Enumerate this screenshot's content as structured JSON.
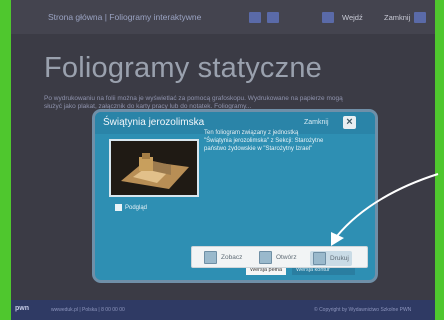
{
  "topbar": {
    "breadcrumb": "Strona główna | Foliogramy interaktywne",
    "icon1": "grid-icon",
    "icon2": "pencil-icon",
    "exit_label": "Wejdź",
    "close_label": "Zamknij"
  },
  "page": {
    "title": "Foliogramy statyczne",
    "intro": "Po wydrukowaniu na folii można je wyświetlać za pomocą grafoskopu. Wydrukowane na papierze mogą służyć jako plakat, załącznik do karty pracy lub do notatek. Foliogramy..."
  },
  "dialog": {
    "title": "Świątynia jerozolimska",
    "close_label": "Zamknij",
    "description": "Ten foliogram związany z jednostką \"Świątynia jerozolimska\" z Sekcji: Starożytne państwo żydowskie w \"Starożytny Izrael\"",
    "preview_label": "Podgląd",
    "tab_active": "Wersja pełna",
    "tab_other": "Wersja kontur",
    "actions": {
      "zoom": "Zobacz",
      "open": "Otwórz",
      "print": "Drukuj"
    }
  },
  "footer": {
    "logo": "pwn",
    "left_text": "wwweduk.pl | Polska | 8 00 00 00",
    "right_text": "© Copyright by Wydawnictwo Szkolne PWN"
  }
}
